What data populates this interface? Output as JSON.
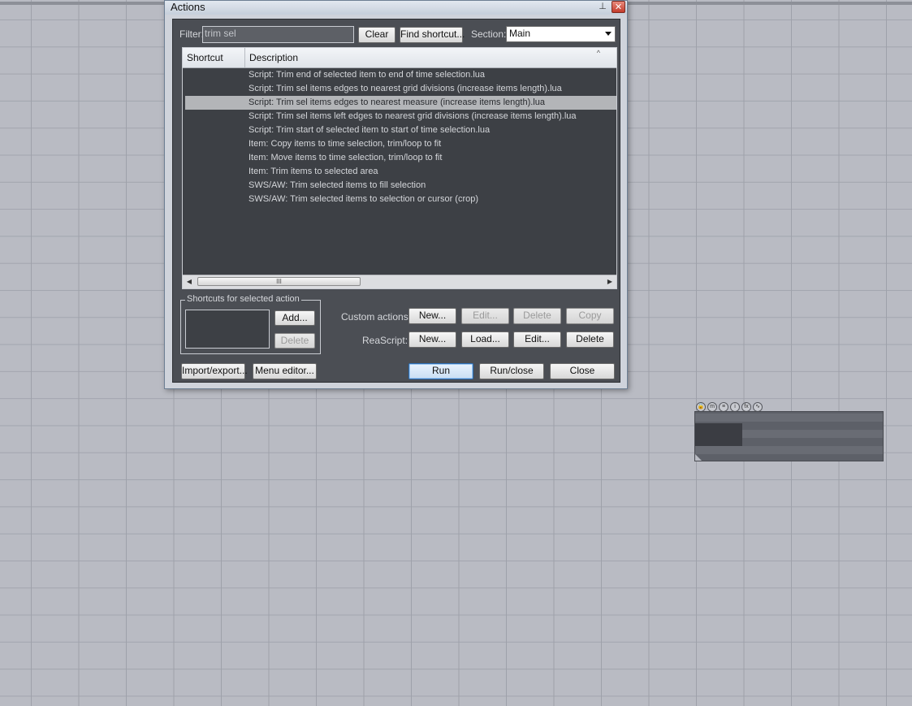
{
  "dialog": {
    "title": "Actions",
    "pin_icon": "pin-icon",
    "close_icon": "close-icon"
  },
  "filter": {
    "label": "Filter:",
    "value": "trim sel",
    "clear_label": "Clear",
    "find_shortcut_label": "Find shortcut...",
    "section_label": "Section:",
    "section_value": "Main"
  },
  "list": {
    "headers": [
      "Shortcut",
      "Description"
    ],
    "sort_icon": "sort-ascending-icon",
    "rows": [
      {
        "shortcut": "",
        "description": "Script: Trim end of selected item to end of time selection.lua"
      },
      {
        "shortcut": "",
        "description": "Script: Trim sel items edges to nearest grid divisions (increase items length).lua"
      },
      {
        "shortcut": "",
        "description": "Script: Trim sel items edges to nearest measure (increase items length).lua"
      },
      {
        "shortcut": "",
        "description": "Script: Trim sel items left edges to nearest grid divisions (increase items length).lua"
      },
      {
        "shortcut": "",
        "description": "Script: Trim start of selected item to start of time selection.lua"
      },
      {
        "shortcut": "",
        "description": "Item: Copy items to time selection, trim/loop to fit"
      },
      {
        "shortcut": "",
        "description": "Item: Move items to time selection, trim/loop to fit"
      },
      {
        "shortcut": "",
        "description": "Item: Trim items to selected area"
      },
      {
        "shortcut": "",
        "description": "SWS/AW: Trim selected items to fill selection"
      },
      {
        "shortcut": "",
        "description": "SWS/AW: Trim selected items to selection or cursor (crop)"
      }
    ],
    "selected_index": 2,
    "scroll_thumb_glyph": "III"
  },
  "shortcuts_group": {
    "title": "Shortcuts for selected action",
    "add_label": "Add...",
    "delete_label": "Delete"
  },
  "custom_actions": {
    "label": "Custom actions:",
    "new_label": "New...",
    "edit_label": "Edit...",
    "delete_label": "Delete",
    "copy_label": "Copy"
  },
  "reascript": {
    "label": "ReaScript:",
    "new_label": "New...",
    "load_label": "Load...",
    "edit_label": "Edit...",
    "delete_label": "Delete"
  },
  "footer": {
    "import_export_label": "Import/export...",
    "menu_editor_label": "Menu editor...",
    "run_label": "Run",
    "run_close_label": "Run/close",
    "close_label": "Close"
  },
  "arrange_item": {
    "buttons": [
      "lock-icon",
      "m",
      "≡",
      "i",
      "fx",
      "envelope-icon"
    ]
  }
}
